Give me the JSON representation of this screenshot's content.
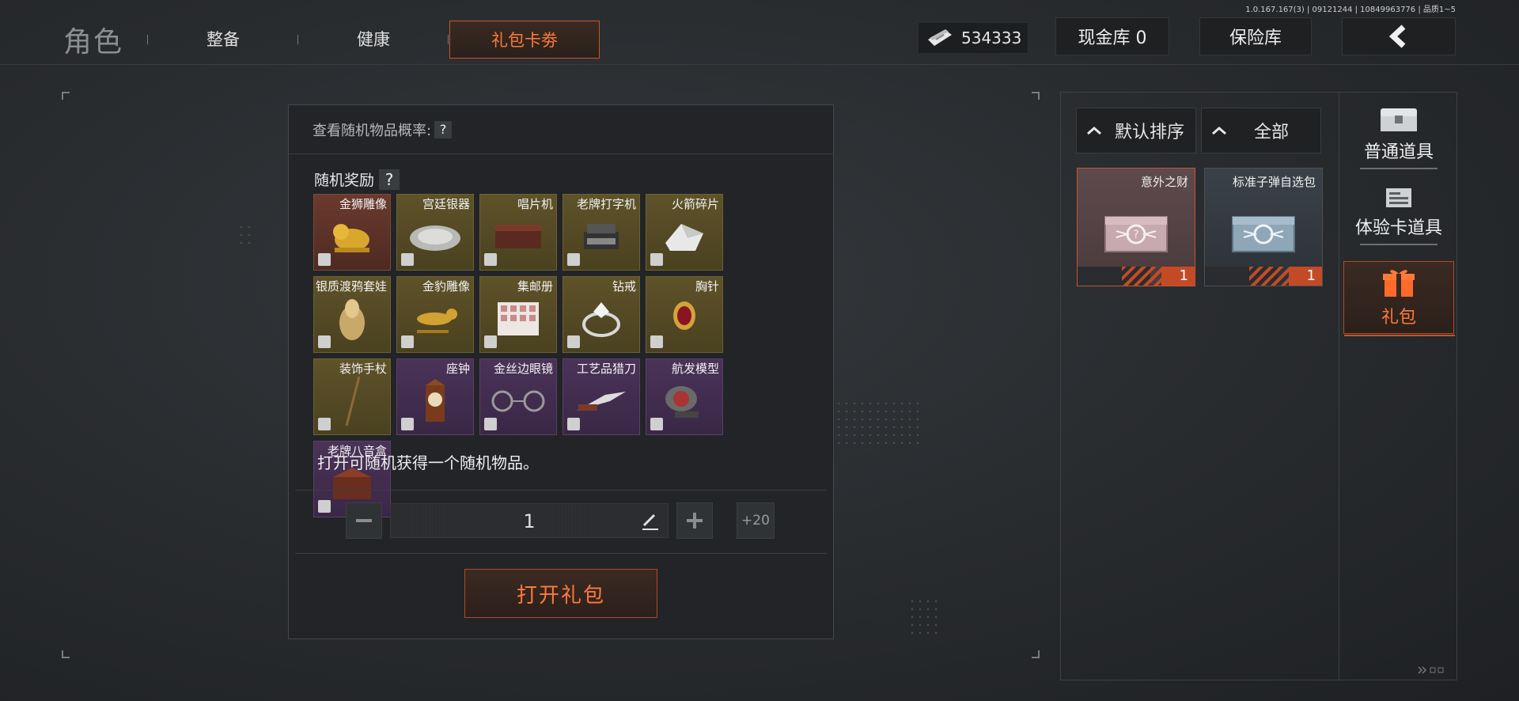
{
  "version": "1.0.167.167(3) | 09121244 | 10849963776 | 品质1~5",
  "header": {
    "title": "角色",
    "tabs": [
      {
        "label": "整备"
      },
      {
        "label": "健康"
      },
      {
        "label": "礼包卡劵"
      }
    ],
    "money": "534333",
    "cash_store": "现金库 0",
    "safe": "保险库",
    "back_icon": "chevron-left-icon"
  },
  "panel": {
    "probability_label": "查看随机物品概率:",
    "help_mark": "?",
    "reward_label": "随机奖励",
    "items": [
      {
        "name": "金狮雕像",
        "rarity": "red"
      },
      {
        "name": "宫廷银器",
        "rarity": "gold"
      },
      {
        "name": "唱片机",
        "rarity": "gold"
      },
      {
        "name": "老牌打字机",
        "rarity": "gold"
      },
      {
        "name": "火箭碎片",
        "rarity": "gold"
      },
      {
        "name": "银质渡鸦套娃",
        "rarity": "gold"
      },
      {
        "name": "金豹雕像",
        "rarity": "gold"
      },
      {
        "name": "集邮册",
        "rarity": "gold"
      },
      {
        "name": "钻戒",
        "rarity": "gold"
      },
      {
        "name": "胸针",
        "rarity": "gold"
      },
      {
        "name": "装饰手杖",
        "rarity": "gold"
      },
      {
        "name": "座钟",
        "rarity": "purple"
      },
      {
        "name": "金丝边眼镜",
        "rarity": "purple"
      },
      {
        "name": "工艺品猎刀",
        "rarity": "purple"
      },
      {
        "name": "航发模型",
        "rarity": "purple"
      },
      {
        "name": "老牌八音盒",
        "rarity": "purple"
      }
    ],
    "description": "打开可随机获得一个随机物品。",
    "quantity": "1",
    "plus20": "+20",
    "open_button": "打开礼包"
  },
  "inventory": {
    "sort_label": "默认排序",
    "filter_label": "全部",
    "cards": [
      {
        "name": "意外之财",
        "count": "1"
      },
      {
        "name": "标准子弹自选包",
        "count": "1"
      }
    ],
    "categories": [
      {
        "label": "普通道具",
        "icon": "chest-icon"
      },
      {
        "label": "体验卡道具",
        "icon": "card-icon"
      },
      {
        "label": "礼包",
        "icon": "gift-icon"
      }
    ]
  },
  "colors": {
    "accent": "#ff7a3a",
    "accent_border": "#c1562e",
    "rarity_red": "#6b3a2e",
    "rarity_gold": "#5e5229",
    "rarity_purple": "#4a3358"
  }
}
